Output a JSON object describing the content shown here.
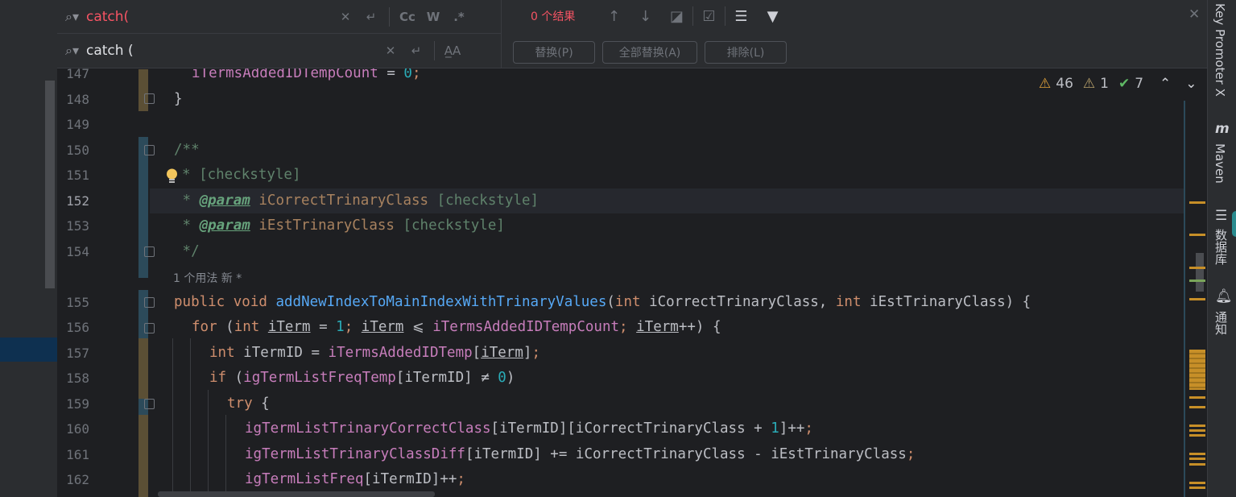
{
  "find": {
    "search_value": "catch(",
    "replace_value": "catch (",
    "result_count": "0 个结果",
    "option_case": "Cc",
    "option_words": "W",
    "option_regex": ".*",
    "option_preserve_case": "A̲A",
    "replace_label": "替换(P)",
    "replace_all_label": "全部替换(A)",
    "exclude_label": "排除(L)"
  },
  "inspections": {
    "warnings": "46",
    "weak_warnings": "1",
    "typos": "7"
  },
  "usage_hint": "1 个用法   新 *",
  "line_numbers": [
    "147",
    "148",
    "149",
    "150",
    "151",
    "152",
    "153",
    "154",
    "155",
    "156",
    "157",
    "158",
    "159",
    "160",
    "161",
    "162"
  ],
  "code": {
    "l147_var": "iTermsAddedIDTempCount",
    "l147_op": " = ",
    "l147_num": "0",
    "l147_end": ";",
    "l148": "}",
    "l150": "/**",
    "l151": "* [checkstyle]",
    "l152_star": " * ",
    "l152_tag": "@param",
    "l152_name": "iCorrectTrinaryClass",
    "l152_rest": " [checkstyle]",
    "l153_star": " * ",
    "l153_tag": "@param",
    "l153_name": "iEstTrinaryClass",
    "l153_rest": " [checkstyle]",
    "l154": " */",
    "l155_kw1": "public",
    "l155_kw2": "void",
    "l155_fn": "addNewIndexToMainIndexWithTrinaryValues",
    "l155_p1t": "int",
    "l155_p1n": "iCorrectTrinaryClass",
    "l155_p2t": "int",
    "l155_p2n": "iEstTrinaryClass",
    "l156_for": "for",
    "l156_int": "int",
    "l156_var": "iTerm",
    "l156_one": "1",
    "l156_le": "⩽",
    "l156_fld": "iTermsAddedIDTempCount",
    "l156_inc": "++",
    "l157_int": "int",
    "l157_var": "iTermID",
    "l157_fld": "iTermsAddedIDTemp",
    "l157_idx": "iTerm",
    "l158_if": "if",
    "l158_fld": "igTermListFreqTemp",
    "l158_idx": "iTermID",
    "l158_ne": "≠",
    "l158_zero": "0",
    "l159_try": "try",
    "l160_fld": "igTermListTrinaryCorrectClass",
    "l160_mid": "[iTermID][iCorrectTrinaryClass + ",
    "l160_one": "1",
    "l160_end": "]++",
    "l161_fld": "igTermListTrinaryClassDiff",
    "l161_mid": "[iTermID] += iCorrectTrinaryClass - iEstTrinaryClass",
    "l162_fld": "igTermListFreq",
    "l162_mid": "[iTermID]++"
  },
  "right_strip": {
    "key_promoter": "Key Promoter X",
    "maven": "Maven",
    "database": "数据库",
    "notifications": "通知"
  },
  "icons": [
    "search-icon",
    "clear-icon",
    "newline-icon",
    "arrow-up-icon",
    "arrow-down-icon",
    "select-all-icon",
    "filter-icon",
    "close-icon",
    "warning-icon",
    "check-icon",
    "chevron-up-icon",
    "chevron-down-icon",
    "maven-icon",
    "database-icon",
    "bell-icon",
    "lightbulb-icon"
  ],
  "colors": {
    "keyword": "#cf8e6d",
    "field": "#c77dbb",
    "method": "#56a8f5",
    "number": "#2aacb8",
    "doc": "#5f826b",
    "error_text": "#f75464"
  }
}
